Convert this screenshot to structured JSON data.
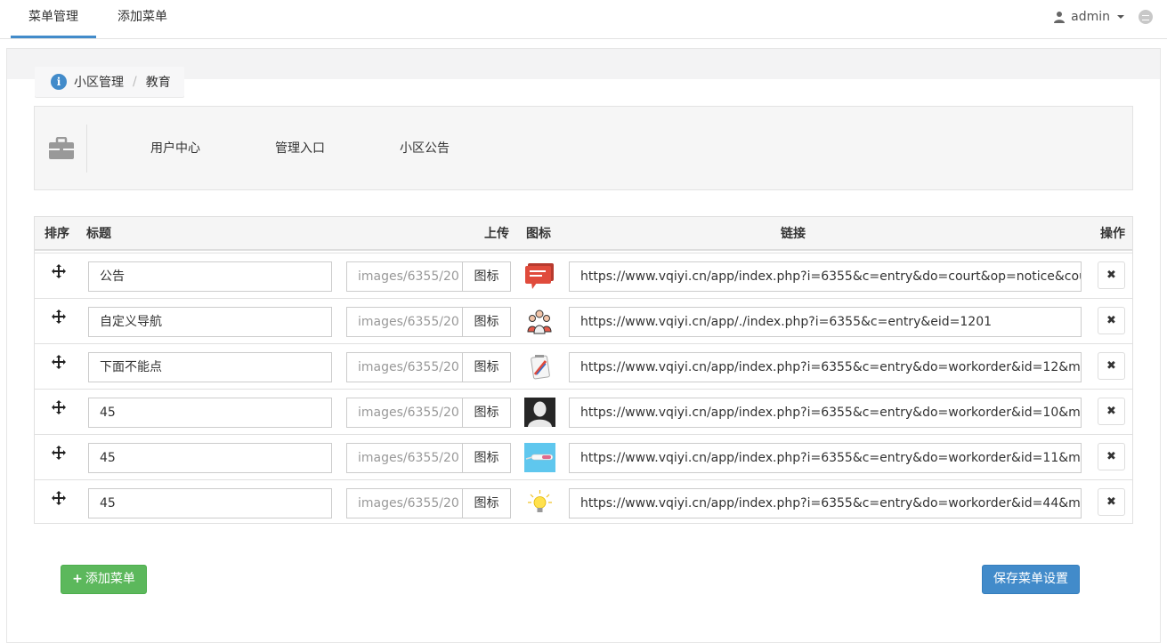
{
  "topnav": {
    "tabs": [
      {
        "label": "菜单管理",
        "active": true
      },
      {
        "label": "添加菜单",
        "active": false
      }
    ],
    "user_name": "admin"
  },
  "breadcrumb": {
    "items": [
      "小区管理",
      "教育"
    ],
    "separator": "/"
  },
  "preview": {
    "nav_items": [
      "用户中心",
      "管理入口",
      "小区公告"
    ]
  },
  "table": {
    "headers": {
      "sort": "排序",
      "title": "标题",
      "upload": "上传",
      "icon": "图标",
      "link": "链接",
      "actions": "操作"
    },
    "rows": [
      {
        "title": "公告",
        "image": "images/6355/20",
        "icon_button": "图标",
        "icon": "speech-bubble-icon",
        "link": "https://www.vqiyi.cn/app/index.php?i=6355&c=entry&do=court&op=notice&cou"
      },
      {
        "title": "自定义导航",
        "image": "images/6355/20",
        "icon_button": "图标",
        "icon": "people-group-icon",
        "link": "https://www.vqiyi.cn/app/./index.php?i=6355&c=entry&eid=1201"
      },
      {
        "title": "下面不能点",
        "image": "images/6355/20",
        "icon_button": "图标",
        "icon": "notepad-pencil-icon",
        "link": "https://www.vqiyi.cn/app/index.php?i=6355&c=entry&do=workorder&id=12&m="
      },
      {
        "title": "45",
        "image": "images/6355/20",
        "icon_button": "图标",
        "icon": "person-silhouette-icon",
        "link": "https://www.vqiyi.cn/app/index.php?i=6355&c=entry&do=workorder&id=10&m="
      },
      {
        "title": "45",
        "image": "images/6355/20",
        "icon_button": "图标",
        "icon": "thermometer-icon",
        "link": "https://www.vqiyi.cn/app/index.php?i=6355&c=entry&do=workorder&id=11&m="
      },
      {
        "title": "45",
        "image": "images/6355/20",
        "icon_button": "图标",
        "icon": "light-bulb-icon",
        "link": "https://www.vqiyi.cn/app/index.php?i=6355&c=entry&do=workorder&id=44&m="
      }
    ]
  },
  "buttons": {
    "add_menu": "添加菜单",
    "save_settings": "保存菜单设置"
  },
  "colors": {
    "primary": "#428bca",
    "success": "#5cb85c"
  }
}
